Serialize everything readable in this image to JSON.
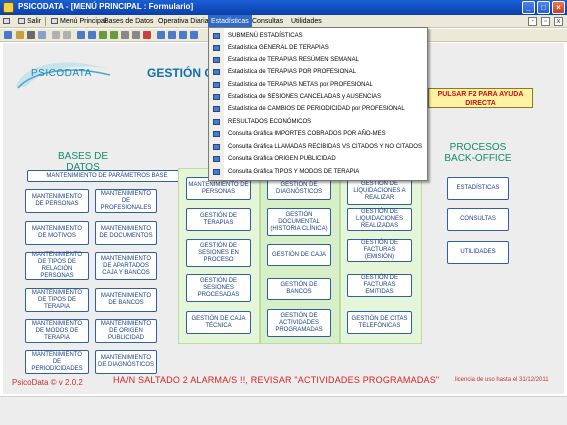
{
  "window": {
    "title": "PSICODATA - [MENÚ PRINCIPAL : Formulario]"
  },
  "menubar": {
    "items": [
      "Salir",
      "Menú Principal",
      "Bases de Datos",
      "Operativa Diaria",
      "Estadísticas",
      "Consultas",
      "Utilidades"
    ],
    "active": "Estadísticas"
  },
  "dropdown": {
    "items": [
      "SUBMENÚ ESTADÍSTICAS",
      "Estadística GENERAL DE TERAPIAS",
      "Estadística de TERAPIAS RESÚMEN SEMANAL",
      "Estadística de TERAPIAS POR PROFESIONAL",
      "Estadística de TERAPIAS NETAS por PROFESIONAL",
      "Estadística de SESIONES CANCELADAS y AUSENCIAS",
      "Estadística de CAMBIOS DE PERIODICIDAD por PROFESIONAL",
      "RESULTADOS ECONÓMICOS",
      "Consulta Gráfica IMPORTES COBRADOS POR AÑO-MES",
      "Consulta Gráfica LLAMADAS RECIBIDAS VS CITADOS Y NO CITADOS",
      "Consulta Gráfica ORIGEN PUBLICIDAD",
      "Consulta Gráfica TIPOS Y MODOS DE TERAPIA"
    ]
  },
  "header": {
    "logo_text": "PSICODATA",
    "title": "GESTIÓN C",
    "help": "PULSAR F2 PARA AYUDA DIRECTA"
  },
  "bases": {
    "title": "BASES DE DATOS",
    "param_button": "MANTENIMIENTO DE PARÁMETROS BASE",
    "left": [
      "MANTENIMIENTO DE PERSONAS",
      "MANTENIMIENTO DE MOTIVOS",
      "MANTENIMIENTO DE TIPOS DE RELACIÓN PERSONAS",
      "MANTENIMIENTO DE TIPOS DE TERAPIA",
      "MANTENIMIENTO DE MODOS DE TERAPIA",
      "MANTENIMIENTO DE PERIODICIDADES"
    ],
    "right": [
      "MANTENIMIENTO DE PROFESIONALES",
      "MANTENIMIENTO DE DOCUMENTOS",
      "MANTENIMIENTO DE APARTADOS CAJA Y BANCOS",
      "MANTENIMIENTO DE BANCOS",
      "MANTENIMIENTO DE ORIGEN PUBLICIDAD",
      "MANTENIMIENTO DE DIAGNÓSTICOS"
    ]
  },
  "operativa": {
    "col1": [
      "MANTENIMIENTO DE PERSONAS",
      "GESTIÓN DE TERAPIAS",
      "GESTIÓN DE SESIONES EN PROCESO",
      "GESTIÓN DE SESIONES PROCESADAS",
      "GESTIÓN DE CAJA TÉCNICA"
    ],
    "col2": [
      "GESTIÓN DE DIAGNÓSTICOS",
      "GESTIÓN DOCUMENTAL (HISTORIA CLÍNICA)",
      "GESTIÓN DE CAJA",
      "GESTIÓN DE BANCOS",
      "GESTIÓN DE ACTIVIDADES PROGRAMADAS"
    ],
    "col3": [
      "GESTIÓN DE LIQUIDACIONES A REALIZAR",
      "GESTIÓN DE LIQUIDACIONES REALIZADAS",
      "GESTIÓN DE FACTURAS (EMISIÓN)",
      "GESTIÓN DE FACTURAS EMITIDAS",
      "GESTIÓN DE CITAS TELEFÓNICAS"
    ]
  },
  "backoffice": {
    "title": "PROCESOS BACK-OFFICE",
    "items": [
      "ESTADÍSTICAS",
      "CONSULTAS",
      "UTILIDADES"
    ]
  },
  "footer": {
    "version": "PsicoData ©  v 2.0.2",
    "warning": "HA/N SALTADO 2 ALARMA/S !!, REVISAR \"ACTIVIDADES PROGRAMADAS\"",
    "license": "licencia de uso hasta el 31/12/2011"
  },
  "colors": {
    "accent": "#316ac5",
    "section": "#148b6a",
    "button_text": "#1a3e86",
    "warning": "#d81f1f"
  }
}
